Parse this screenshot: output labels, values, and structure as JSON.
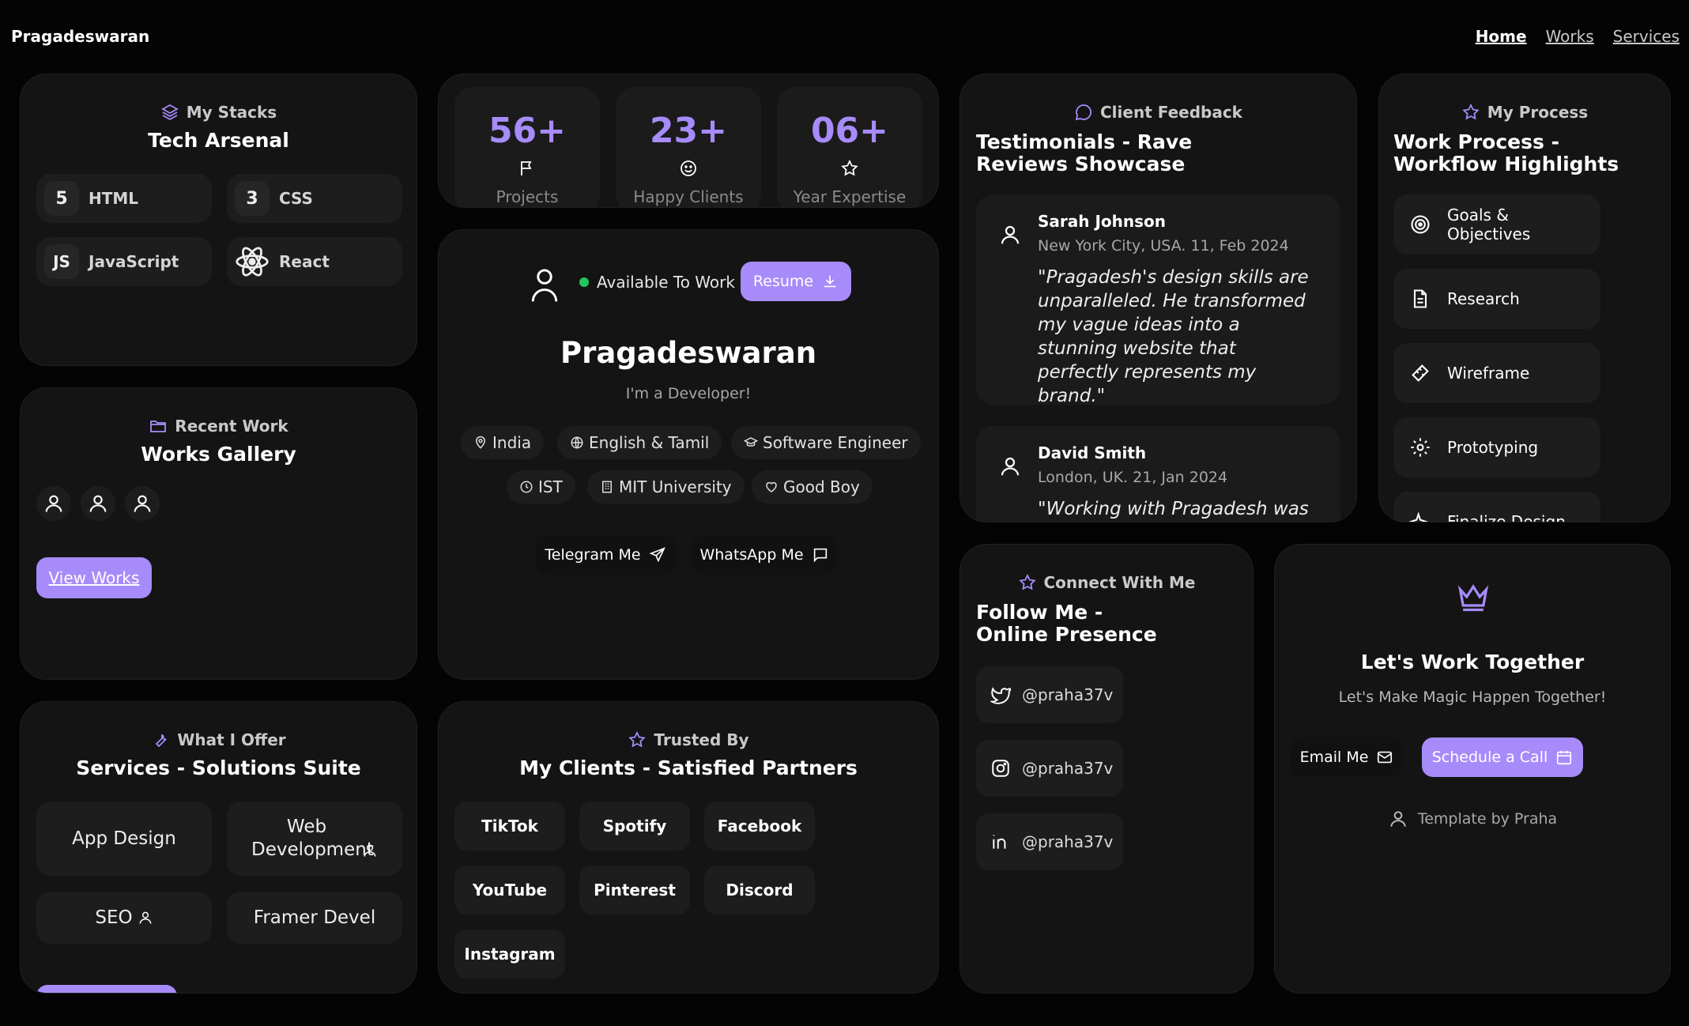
{
  "header": {
    "brand": "Pragadeswaran",
    "nav": [
      "Home",
      "Works",
      "Services"
    ]
  },
  "stacks": {
    "kicker": "My Stacks",
    "title": "Tech Arsenal",
    "items": [
      {
        "label": "HTML",
        "icon": "html5-icon",
        "glyph": "5"
      },
      {
        "label": "CSS",
        "icon": "css3-icon",
        "glyph": "3"
      },
      {
        "label": "JavaScript",
        "icon": "js-icon",
        "glyph": "JS"
      },
      {
        "label": "React",
        "icon": "react-icon",
        "glyph": ""
      }
    ]
  },
  "stats": [
    {
      "value": "56+",
      "label": "Projects",
      "icon": "flag-icon"
    },
    {
      "value": "23+",
      "label": "Happy Clients",
      "icon": "smile-icon"
    },
    {
      "value": "06+",
      "label": "Year Expertise",
      "icon": "star-icon"
    }
  ],
  "profile": {
    "status": "Available To Work",
    "resume_label": "Resume",
    "name": "Pragadeswaran",
    "role": "I'm a Developer!",
    "tags_row1": [
      "India",
      "English & Tamil",
      "Software Engineer"
    ],
    "tags_row2": [
      "IST",
      "MIT University",
      "Good Boy"
    ],
    "telegram_label": "Telegram Me",
    "whatsapp_label": "WhatsApp Me",
    "status_color": "#22c55e"
  },
  "works": {
    "kicker": "Recent Work",
    "title": "Works Gallery",
    "button": "View Works"
  },
  "feedback": {
    "kicker": "Client Feedback",
    "title_line1": "Testimonials - Rave",
    "title_line2": "Reviews Showcase",
    "items": [
      {
        "name": "Sarah Johnson",
        "meta": "New York City, USA. 11, Feb 2024",
        "quote": "\"Pragadesh's design skills are unparalleled. He transformed my vague ideas into a stunning website that perfectly represents my brand.\""
      },
      {
        "name": "David Smith",
        "meta": "London, UK. 21, Jan 2024",
        "quote": "\"Working with Pragadesh was a"
      }
    ]
  },
  "process": {
    "kicker": "My Process",
    "title_line1": "Work Process -",
    "title_line2": "Workflow Highlights",
    "items": [
      {
        "label": "Goals & Objectives",
        "icon": "target-icon"
      },
      {
        "label": "Research",
        "icon": "document-icon"
      },
      {
        "label": "Wireframe",
        "icon": "ruler-icon"
      },
      {
        "label": "Prototyping",
        "icon": "gear-icon"
      },
      {
        "label": "Finalize Design",
        "icon": "sparkle-icon"
      }
    ]
  },
  "services": {
    "kicker": "What I Offer",
    "title": "Services - Solutions Suite",
    "items": [
      "App Design",
      "Web Development",
      "SEO",
      "Framer Devel"
    ]
  },
  "clients": {
    "kicker": "Trusted By",
    "title": "My Clients - Satisfied Partners",
    "items": [
      "TikTok",
      "Spotify",
      "Facebook",
      "YouTube",
      "Pinterest",
      "Discord",
      "Instagram"
    ]
  },
  "connect": {
    "kicker": "Connect With Me",
    "title_line1": "Follow Me -",
    "title_line2": "Online Presence",
    "items": [
      {
        "handle": "@praha37v",
        "icon": "twitter-icon"
      },
      {
        "handle": "@praha37v",
        "icon": "instagram-icon"
      },
      {
        "handle": "@praha37v",
        "icon": "linkedin-icon"
      }
    ]
  },
  "cta": {
    "title": "Let's Work Together",
    "subtitle": "Let's Make Magic Happen Together!",
    "email_label": "Email Me",
    "call_label": "Schedule a Call",
    "credit": "Template by Praha"
  },
  "theme": {
    "accent": "#a78bfa",
    "card": "#141414",
    "bg": "#040404"
  }
}
